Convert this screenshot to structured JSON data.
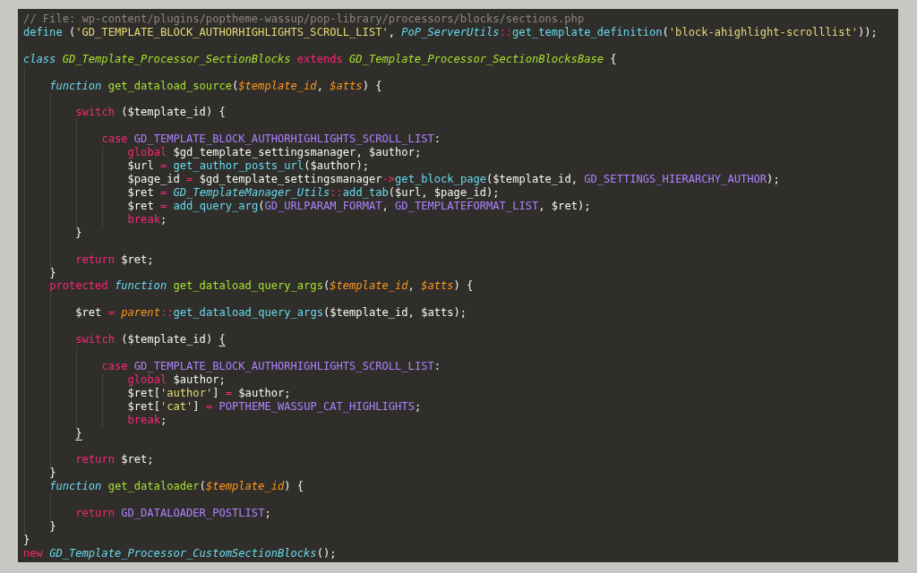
{
  "editor": {
    "lines": [
      {
        "kind": "code",
        "tokens": [
          {
            "kind": "comment",
            "text": "// File: wp-content/plugins/poptheme-wassup/pop-library/processors/blocks/sections.php"
          }
        ]
      },
      {
        "kind": "code",
        "tokens": [
          {
            "kind": "support",
            "text": "define"
          },
          {
            "kind": "plain",
            "text": " ("
          },
          {
            "kind": "string",
            "text": "'GD_TEMPLATE_BLOCK_AUTHORHIGHLIGHTS_SCROLL_LIST'"
          },
          {
            "kind": "plain",
            "text": ", "
          },
          {
            "kind": "support_class",
            "text": "PoP_ServerUtils"
          },
          {
            "kind": "operator",
            "text": "::"
          },
          {
            "kind": "support",
            "text": "get_template_definition"
          },
          {
            "kind": "plain",
            "text": "("
          },
          {
            "kind": "string",
            "text": "'block-ahighlight-scrolllist'"
          },
          {
            "kind": "plain",
            "text": "));"
          }
        ]
      },
      {
        "kind": "blank"
      },
      {
        "kind": "code",
        "tokens": [
          {
            "kind": "storage",
            "text": "class "
          },
          {
            "kind": "class_name",
            "text": "GD_Template_Processor_SectionBlocks"
          },
          {
            "kind": "keyword",
            "text": " extends "
          },
          {
            "kind": "class_name",
            "text": "GD_Template_Processor_SectionBlocksBase"
          },
          {
            "kind": "plain",
            "text": " {"
          }
        ],
        "children": [
          {
            "kind": "blank"
          },
          {
            "kind": "code",
            "tokens": [
              {
                "kind": "storage",
                "text": "function "
              },
              {
                "kind": "function",
                "text": "get_dataload_source"
              },
              {
                "kind": "plain",
                "text": "("
              },
              {
                "kind": "param",
                "text": "$template_id"
              },
              {
                "kind": "plain",
                "text": ", "
              },
              {
                "kind": "param",
                "text": "$atts"
              },
              {
                "kind": "plain",
                "text": ") {"
              }
            ],
            "children": [
              {
                "kind": "blank"
              },
              {
                "kind": "code",
                "tokens": [
                  {
                    "kind": "keyword",
                    "text": "switch"
                  },
                  {
                    "kind": "plain",
                    "text": " ($template_id) {"
                  }
                ],
                "children": [
                  {
                    "kind": "blank"
                  },
                  {
                    "kind": "code",
                    "tokens": [
                      {
                        "kind": "keyword",
                        "text": "case "
                      },
                      {
                        "kind": "constant",
                        "text": "GD_TEMPLATE_BLOCK_AUTHORHIGHLIGHTS_SCROLL_LIST"
                      },
                      {
                        "kind": "plain",
                        "text": ":"
                      }
                    ],
                    "children": [
                      {
                        "kind": "code",
                        "tokens": [
                          {
                            "kind": "keyword",
                            "text": "global"
                          },
                          {
                            "kind": "plain",
                            "text": " $gd_template_settingsmanager, $author;"
                          }
                        ]
                      },
                      {
                        "kind": "code",
                        "tokens": [
                          {
                            "kind": "plain",
                            "text": "$url "
                          },
                          {
                            "kind": "operator",
                            "text": "="
                          },
                          {
                            "kind": "support",
                            "text": " get_author_posts_url"
                          },
                          {
                            "kind": "plain",
                            "text": "($author);"
                          }
                        ]
                      },
                      {
                        "kind": "code",
                        "tokens": [
                          {
                            "kind": "plain",
                            "text": "$page_id "
                          },
                          {
                            "kind": "operator",
                            "text": "="
                          },
                          {
                            "kind": "plain",
                            "text": " $gd_template_settingsmanager"
                          },
                          {
                            "kind": "operator",
                            "text": "->"
                          },
                          {
                            "kind": "support",
                            "text": "get_block_page"
                          },
                          {
                            "kind": "plain",
                            "text": "($template_id, "
                          },
                          {
                            "kind": "constant",
                            "text": "GD_SETTINGS_HIERARCHY_AUTHOR"
                          },
                          {
                            "kind": "plain",
                            "text": ");"
                          }
                        ]
                      },
                      {
                        "kind": "code",
                        "tokens": [
                          {
                            "kind": "plain",
                            "text": "$ret "
                          },
                          {
                            "kind": "operator",
                            "text": "="
                          },
                          {
                            "kind": "support_class",
                            "text": " GD_TemplateManager_Utils"
                          },
                          {
                            "kind": "operator",
                            "text": "::"
                          },
                          {
                            "kind": "support",
                            "text": "add_tab"
                          },
                          {
                            "kind": "plain",
                            "text": "($url, $page_id);"
                          }
                        ]
                      },
                      {
                        "kind": "code",
                        "tokens": [
                          {
                            "kind": "plain",
                            "text": "$ret "
                          },
                          {
                            "kind": "operator",
                            "text": "="
                          },
                          {
                            "kind": "support",
                            "text": " add_query_arg"
                          },
                          {
                            "kind": "plain",
                            "text": "("
                          },
                          {
                            "kind": "constant",
                            "text": "GD_URLPARAM_FORMAT"
                          },
                          {
                            "kind": "plain",
                            "text": ", "
                          },
                          {
                            "kind": "constant",
                            "text": "GD_TEMPLATEFORMAT_LIST"
                          },
                          {
                            "kind": "plain",
                            "text": ", $ret);"
                          }
                        ]
                      },
                      {
                        "kind": "code",
                        "tokens": [
                          {
                            "kind": "keyword",
                            "text": "break"
                          },
                          {
                            "kind": "plain",
                            "text": ";"
                          }
                        ]
                      }
                    ]
                  }
                ]
              },
              {
                "kind": "code",
                "tokens": [
                  {
                    "kind": "plain",
                    "text": "}"
                  }
                ]
              },
              {
                "kind": "blank"
              },
              {
                "kind": "code",
                "tokens": [
                  {
                    "kind": "keyword",
                    "text": "return"
                  },
                  {
                    "kind": "plain",
                    "text": " $ret;"
                  }
                ]
              }
            ]
          },
          {
            "kind": "code",
            "tokens": [
              {
                "kind": "plain",
                "text": "}"
              }
            ]
          },
          {
            "kind": "code",
            "tokens": [
              {
                "kind": "keyword",
                "text": "protected "
              },
              {
                "kind": "storage",
                "text": "function "
              },
              {
                "kind": "function",
                "text": "get_dataload_query_args"
              },
              {
                "kind": "plain",
                "text": "("
              },
              {
                "kind": "param",
                "text": "$template_id"
              },
              {
                "kind": "plain",
                "text": ", "
              },
              {
                "kind": "param",
                "text": "$atts"
              },
              {
                "kind": "plain",
                "text": ") {"
              }
            ],
            "children": [
              {
                "kind": "blank"
              },
              {
                "kind": "code",
                "tokens": [
                  {
                    "kind": "plain",
                    "text": "$ret "
                  },
                  {
                    "kind": "operator",
                    "text": "="
                  },
                  {
                    "kind": "param",
                    "text": " parent"
                  },
                  {
                    "kind": "operator",
                    "text": "::"
                  },
                  {
                    "kind": "support",
                    "text": "get_dataload_query_args"
                  },
                  {
                    "kind": "plain",
                    "text": "($template_id, $atts);"
                  }
                ]
              },
              {
                "kind": "blank"
              },
              {
                "kind": "code",
                "tokens": [
                  {
                    "kind": "keyword",
                    "text": "switch"
                  },
                  {
                    "kind": "plain",
                    "text": " ($template_id) "
                  },
                  {
                    "kind": "plain",
                    "text": "{",
                    "bracket_match": true
                  }
                ],
                "children": [
                  {
                    "kind": "blank"
                  },
                  {
                    "kind": "code",
                    "tokens": [
                      {
                        "kind": "keyword",
                        "text": "case "
                      },
                      {
                        "kind": "constant",
                        "text": "GD_TEMPLATE_BLOCK_AUTHORHIGHLIGHTS_SCROLL_LIST"
                      },
                      {
                        "kind": "plain",
                        "text": ":"
                      }
                    ],
                    "children": [
                      {
                        "kind": "code",
                        "tokens": [
                          {
                            "kind": "keyword",
                            "text": "global"
                          },
                          {
                            "kind": "plain",
                            "text": " $author;"
                          }
                        ]
                      },
                      {
                        "kind": "code",
                        "tokens": [
                          {
                            "kind": "plain",
                            "text": "$ret["
                          },
                          {
                            "kind": "string",
                            "text": "'author'"
                          },
                          {
                            "kind": "plain",
                            "text": "] "
                          },
                          {
                            "kind": "operator",
                            "text": "="
                          },
                          {
                            "kind": "plain",
                            "text": " $author;"
                          }
                        ]
                      },
                      {
                        "kind": "code",
                        "tokens": [
                          {
                            "kind": "plain",
                            "text": "$ret["
                          },
                          {
                            "kind": "string",
                            "text": "'cat'"
                          },
                          {
                            "kind": "plain",
                            "text": "] "
                          },
                          {
                            "kind": "operator",
                            "text": "="
                          },
                          {
                            "kind": "constant",
                            "text": " POPTHEME_WASSUP_CAT_HIGHLIGHTS"
                          },
                          {
                            "kind": "plain",
                            "text": ";"
                          }
                        ]
                      },
                      {
                        "kind": "code",
                        "tokens": [
                          {
                            "kind": "keyword",
                            "text": "break"
                          },
                          {
                            "kind": "plain",
                            "text": ";"
                          }
                        ]
                      }
                    ]
                  }
                ]
              },
              {
                "kind": "code",
                "tokens": [
                  {
                    "kind": "plain",
                    "text": "}",
                    "bracket_match": true
                  }
                ]
              },
              {
                "kind": "blank"
              },
              {
                "kind": "code",
                "tokens": [
                  {
                    "kind": "keyword",
                    "text": "return"
                  },
                  {
                    "kind": "plain",
                    "text": " $ret;"
                  }
                ]
              }
            ]
          },
          {
            "kind": "code",
            "tokens": [
              {
                "kind": "plain",
                "text": "}"
              }
            ]
          },
          {
            "kind": "code",
            "tokens": [
              {
                "kind": "storage",
                "text": "function "
              },
              {
                "kind": "function",
                "text": "get_dataloader"
              },
              {
                "kind": "plain",
                "text": "("
              },
              {
                "kind": "param",
                "text": "$template_id"
              },
              {
                "kind": "plain",
                "text": ") {"
              }
            ],
            "children": [
              {
                "kind": "blank"
              },
              {
                "kind": "code",
                "tokens": [
                  {
                    "kind": "keyword",
                    "text": "return "
                  },
                  {
                    "kind": "constant",
                    "text": "GD_DATALOADER_POSTLIST"
                  },
                  {
                    "kind": "plain",
                    "text": ";"
                  }
                ]
              }
            ]
          },
          {
            "kind": "code",
            "tokens": [
              {
                "kind": "plain",
                "text": "}"
              }
            ]
          }
        ]
      },
      {
        "kind": "code",
        "tokens": [
          {
            "kind": "plain",
            "text": "}"
          }
        ]
      },
      {
        "kind": "code",
        "tokens": [
          {
            "kind": "keyword",
            "text": "new "
          },
          {
            "kind": "support_class",
            "text": "GD_Template_Processor_CustomSectionBlocks"
          },
          {
            "kind": "plain",
            "text": "();"
          }
        ]
      }
    ]
  }
}
